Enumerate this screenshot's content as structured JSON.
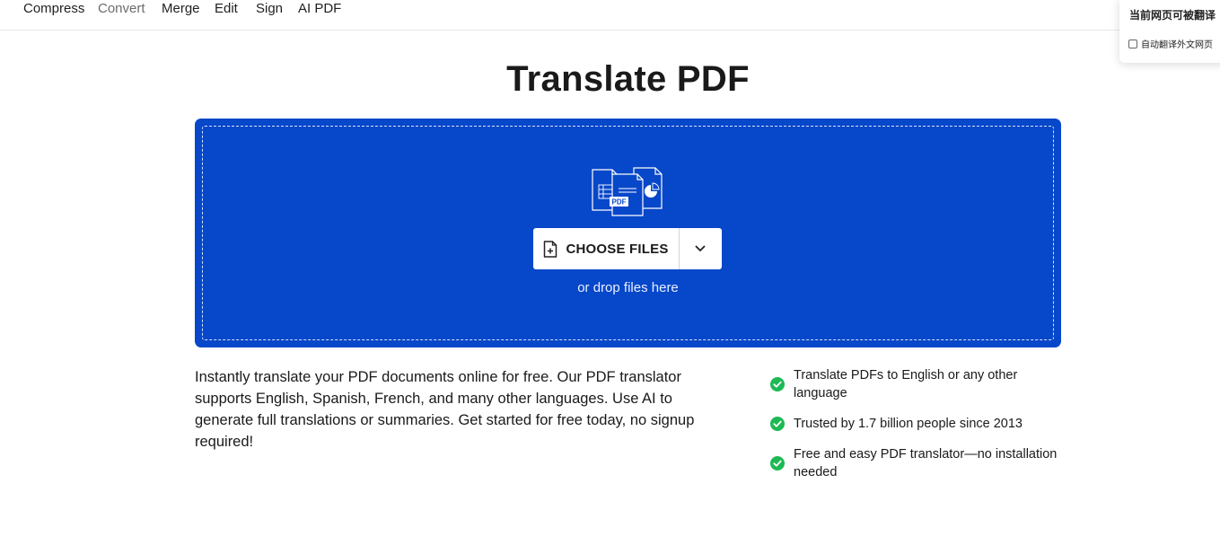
{
  "nav": {
    "items": [
      {
        "label": "Compress",
        "muted": false
      },
      {
        "label": "Convert",
        "muted": true
      },
      {
        "label": "Merge",
        "muted": false
      },
      {
        "label": "Edit",
        "muted": false
      },
      {
        "label": "Sign",
        "muted": false
      },
      {
        "label": "AI PDF",
        "muted": false
      }
    ]
  },
  "translate_popup": {
    "title": "当前网页可被翻译",
    "auto_translate_label": "自动翻译外文网页"
  },
  "page": {
    "title": "Translate PDF"
  },
  "dropzone": {
    "pdf_badge": "PDF",
    "choose_files_label": "CHOOSE FILES",
    "drop_hint": "or drop files here",
    "background_color": "#0747c9"
  },
  "description": "Instantly translate your PDF documents online for free. Our PDF translator supports English, Spanish, French, and many other languages. Use AI to generate full translations or summaries. Get started for free today, no signup required!",
  "features": [
    {
      "text": "Translate PDFs to English or any other language"
    },
    {
      "text": "Trusted by 1.7 billion people since 2013"
    },
    {
      "text": "Free and easy PDF translator—no installation needed"
    }
  ],
  "colors": {
    "check_green": "#1db954",
    "accent_blue": "#0747c9"
  }
}
